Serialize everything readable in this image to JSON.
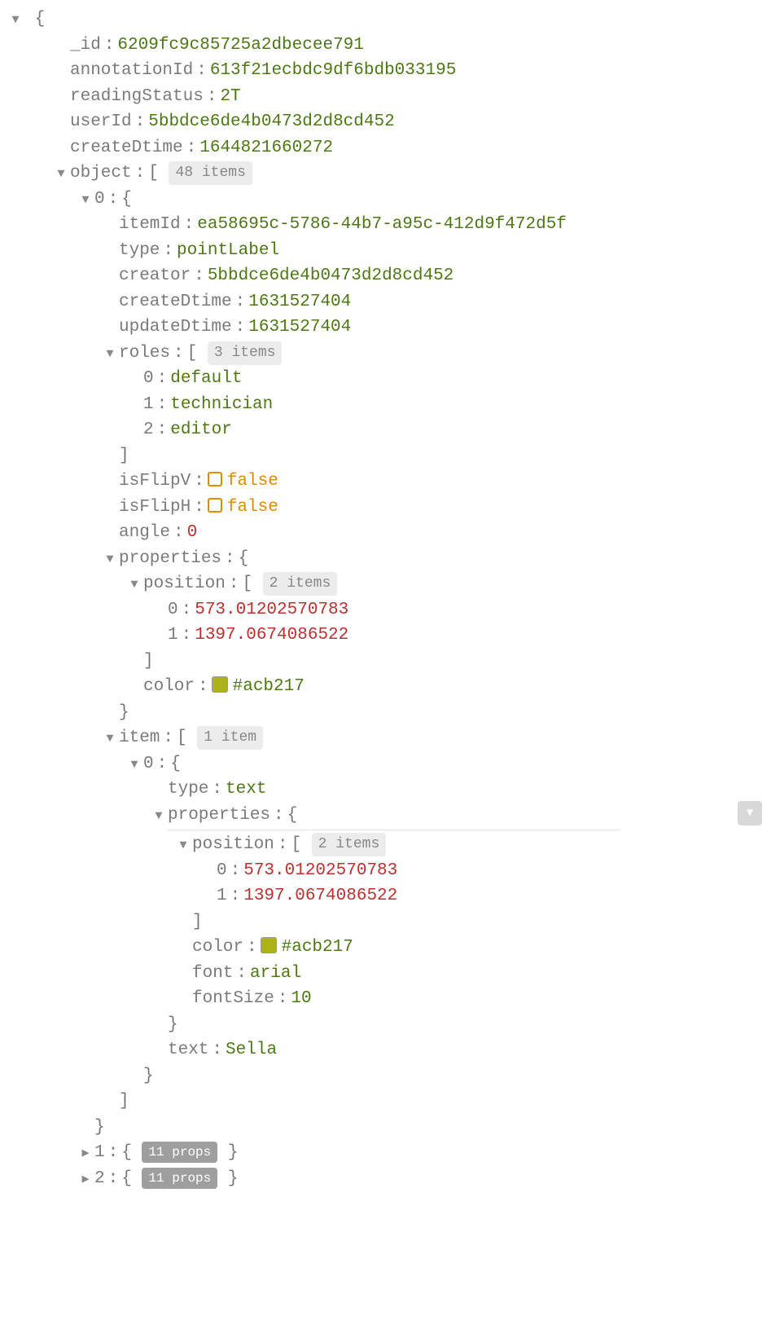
{
  "root": {
    "_id_k": "_id",
    "_id_v": "6209fc9c85725a2dbecee791",
    "ann_k": "annotationId",
    "ann_v": "613f21ecbdc9df6bdb033195",
    "rs_k": "readingStatus",
    "rs_v": "2T",
    "uid_k": "userId",
    "uid_v": "5bbdce6de4b0473d2d8cd452",
    "cd_k": "createDtime",
    "cd_v": "1644821660272",
    "obj_k": "object",
    "obj_badge": "48 items",
    "o0_k": "0",
    "o0": {
      "itemId_k": "itemId",
      "itemId_v": "ea58695c-5786-44b7-a95c-412d9f472d5f",
      "type_k": "type",
      "type_v": "pointLabel",
      "creator_k": "creator",
      "creator_v": "5bbdce6de4b0473d2d8cd452",
      "cd_k": "createDtime",
      "cd_v": "1631527404",
      "ud_k": "updateDtime",
      "ud_v": "1631527404",
      "roles_k": "roles",
      "roles_badge": "3 items",
      "roles": {
        "i0": "0",
        "v0": "default",
        "i1": "1",
        "v1": "technician",
        "i2": "2",
        "v2": "editor"
      },
      "flipv_k": "isFlipV",
      "flipv_v": "false",
      "fliph_k": "isFlipH",
      "fliph_v": "false",
      "angle_k": "angle",
      "angle_v": "0",
      "props_k": "properties",
      "props": {
        "pos_k": "position",
        "pos_badge": "2 items",
        "p0_k": "0",
        "p0_v": "573.01202570783",
        "p1_k": "1",
        "p1_v": "1397.0674086522",
        "color_k": "color",
        "color_v": "#acb217"
      },
      "item_k": "item",
      "item_badge": "1 item",
      "i0_k": "0",
      "i0": {
        "type_k": "type",
        "type_v": "text",
        "props_k": "properties",
        "pos_k": "position",
        "pos_badge": "2 items",
        "p0_k": "0",
        "p0_v": "573.01202570783",
        "p1_k": "1",
        "p1_v": "1397.0674086522",
        "color_k": "color",
        "color_v": "#acb217",
        "font_k": "font",
        "font_v": "arial",
        "fs_k": "fontSize",
        "fs_v": "10",
        "text_k": "text",
        "text_v": "Sella"
      }
    },
    "o1_k": "1",
    "o1_badge": "11 props",
    "o2_k": "2",
    "o2_badge": "11 props"
  },
  "brace_open": "{",
  "brace_close": "}",
  "bracket_open": "[",
  "bracket_close": "]"
}
